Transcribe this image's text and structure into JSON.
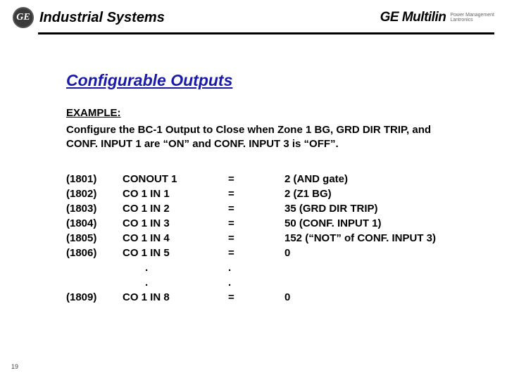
{
  "header": {
    "logo_text": "GE",
    "title": "Industrial Systems",
    "brand_main": "GE Multilin",
    "brand_sub1": "Power Management",
    "brand_sub2": "Lantronics"
  },
  "slide": {
    "title": "Configurable Outputs",
    "example_label": "EXAMPLE:",
    "example_text": "Configure the BC-1 Output to Close when Zone 1 BG, GRD DIR TRIP, and CONF. INPUT 1 are “ON” and CONF. INPUT 3 is “OFF”."
  },
  "rows": [
    {
      "addr": "(1801)",
      "name": "CONOUT 1",
      "eq": "=",
      "val": "2 (AND gate)"
    },
    {
      "addr": "(1802)",
      "name": "CO 1 IN 1",
      "eq": "=",
      "val": "2 (Z1 BG)"
    },
    {
      "addr": "(1803)",
      "name": "CO 1 IN 2",
      "eq": "=",
      "val": "35 (GRD DIR TRIP)"
    },
    {
      "addr": "(1804)",
      "name": "CO 1 IN 3",
      "eq": "=",
      "val": "50 (CONF. INPUT 1)"
    },
    {
      "addr": "(1805)",
      "name": "CO 1 IN 4",
      "eq": "=",
      "val": "152 (“NOT” of CONF. INPUT 3)"
    },
    {
      "addr": "(1806)",
      "name": "CO 1 IN 5",
      "eq": "=",
      "val": "0"
    },
    {
      "addr": "",
      "name": ".",
      "eq": ".",
      "val": ""
    },
    {
      "addr": "",
      "name": ".",
      "eq": ".",
      "val": ""
    },
    {
      "addr": "(1809)",
      "name": "CO 1 IN 8",
      "eq": "=",
      "val": "0"
    }
  ],
  "page_number": "19"
}
